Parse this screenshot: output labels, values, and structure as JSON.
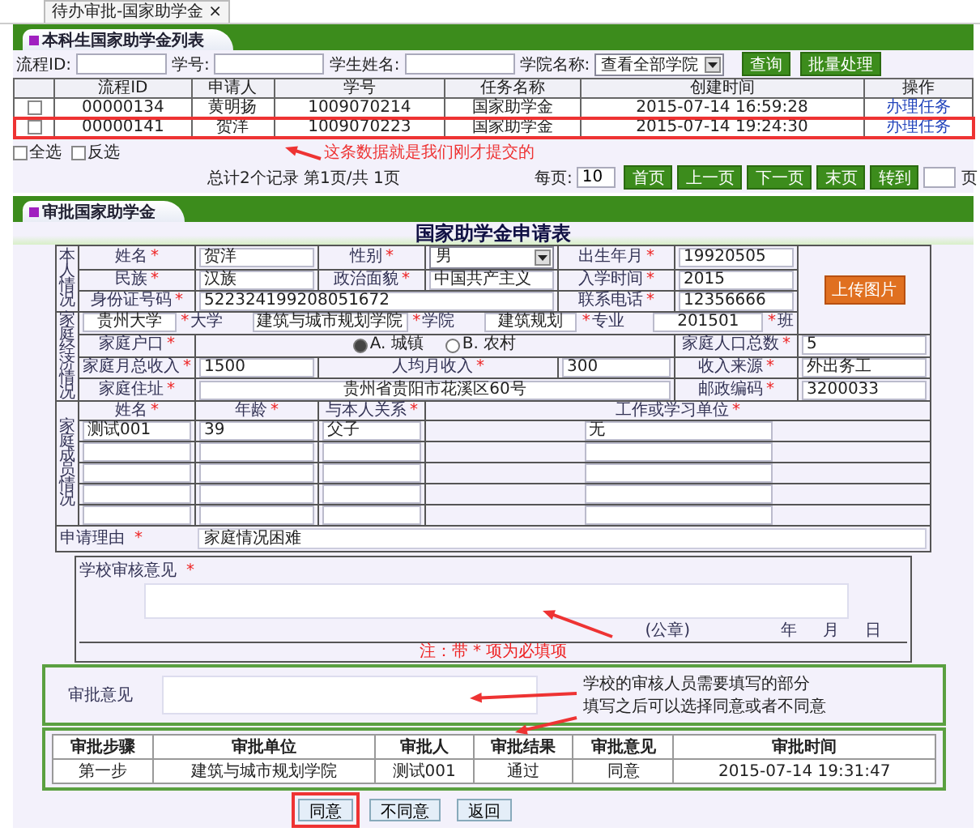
{
  "browser_tab": {
    "label": "待办审批-国家助学金",
    "close": "×"
  },
  "required_mark": "*",
  "list_panel": {
    "title": "本科生国家助学金列表",
    "filters": [
      {
        "kind": "text",
        "label": "流程ID:"
      },
      {
        "kind": "text",
        "label": "学号:"
      },
      {
        "kind": "text",
        "label": "学生姓名:"
      },
      {
        "kind": "select",
        "label": "学院名称:",
        "value": "查看全部学院"
      }
    ],
    "buttons": [
      "查询",
      "批量处理"
    ],
    "table": {
      "columns": [
        "流程ID",
        "申请人",
        "学号",
        "任务名称",
        "创建时间",
        "操作"
      ],
      "rows": [
        {
          "checked": false,
          "annotated": false,
          "cells": [
            "00000134",
            "黄明扬",
            "1009070214",
            "国家助学金",
            "2015-07-14 16:59:28"
          ],
          "action": "办理任务"
        },
        {
          "checked": false,
          "annotated": true,
          "cells": [
            "00000141",
            "贺洋",
            "1009070223",
            "国家助学金",
            "2015-07-14 19:24:30"
          ],
          "action": "办理任务"
        }
      ]
    },
    "select_all": {
      "label": "全选",
      "checked": false
    },
    "invert": {
      "label": "反选",
      "checked": false
    },
    "note": "这条数据就是我们刚才提交的",
    "summary": "总计2个记录 第1页/共 1页",
    "page_size": {
      "label": "每页:",
      "value": "10"
    },
    "pager": [
      "首页",
      "上一页",
      "下一页",
      "末页",
      "转到"
    ],
    "page_unit": "页"
  },
  "approval_panel": {
    "title": "审批国家助学金",
    "form_title": "国家助学金申请表",
    "sections": {
      "self": "本人情况",
      "economy": "家庭经济情况",
      "family": "家庭成员情况"
    },
    "personal": {
      "name": {
        "label": "姓名",
        "value": "贺洋"
      },
      "gender": {
        "label": "性别",
        "value": "男"
      },
      "birth": {
        "label": "出生年月",
        "value": "19920505"
      },
      "ethnicity": {
        "label": "民族",
        "value": "汉族"
      },
      "political": {
        "label": "政治面貌",
        "value": "中国共产主义"
      },
      "enrollment": {
        "label": "入学时间",
        "value": "2015"
      },
      "id_number": {
        "label": "身份证号码",
        "value": "522324199208051672"
      },
      "phone": {
        "label": "联系电话",
        "value": "12356666"
      },
      "school": [
        {
          "value": "贵州大学",
          "label": "大学"
        },
        {
          "value": "建筑与城市规划学院",
          "label": "学院"
        },
        {
          "value": "建筑规划",
          "label": "专业"
        },
        {
          "value": "201501",
          "label": "班"
        }
      ],
      "photo_button": "上传图片"
    },
    "economy": {
      "household": {
        "label": "家庭户口",
        "options": [
          {
            "label": "A. 城镇",
            "selected": true
          },
          {
            "label": "B. 农村",
            "selected": false
          }
        ]
      },
      "family_size": {
        "label": "家庭人口总数",
        "value": "5"
      },
      "monthly_income": {
        "label": "家庭月总收入",
        "value": "1500"
      },
      "per_capita": {
        "label": "人均月收入",
        "value": "300"
      },
      "income_source": {
        "label": "收入来源",
        "value": "外出务工"
      },
      "address": {
        "label": "家庭住址",
        "value": "贵州省贵阳市花溪区60号"
      },
      "postcode": {
        "label": "邮政编码",
        "value": "3200033"
      }
    },
    "family": {
      "columns": [
        "姓名",
        "年龄",
        "与本人关系",
        "工作或学习单位"
      ],
      "rows": [
        {
          "name": "测试001",
          "age": "39",
          "relation": "父子",
          "workplace": "无"
        }
      ]
    },
    "reason": {
      "label": "申请理由",
      "value": "家庭情况困难"
    },
    "school_review": {
      "label": "学校审核意见",
      "seal": "(公章)",
      "date": [
        "年",
        "月",
        "日"
      ]
    },
    "required_note": "注：带 * 项为必填项",
    "review": {
      "label": "审批意见",
      "note": "学校的审核人员需要填写的部分"
    },
    "history": {
      "note": "填写之后可以选择同意或者不同意",
      "columns": [
        "审批步骤",
        "审批单位",
        "审批人",
        "审批结果",
        "审批意见",
        "审批时间"
      ],
      "rows": [
        {
          "cells": [
            "第一步",
            "建筑与城市规划学院",
            "测试001",
            "通过",
            "同意",
            "2015-07-14 19:31:47"
          ]
        }
      ]
    },
    "actions": [
      {
        "label": "同意",
        "annotated": true
      },
      {
        "label": "不同意",
        "annotated": false
      },
      {
        "label": "返回",
        "annotated": false
      }
    ]
  }
}
